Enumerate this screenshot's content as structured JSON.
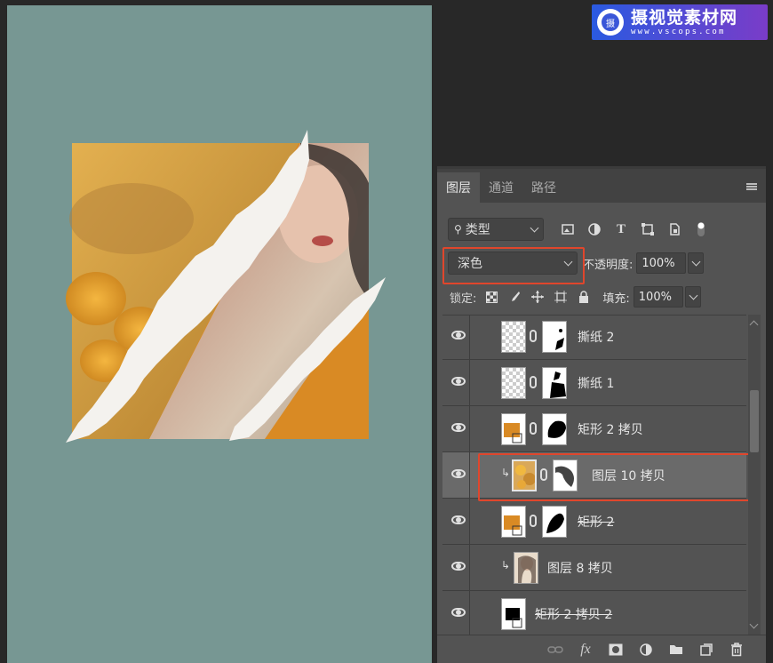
{
  "watermark": {
    "title": "摄视觉素材网",
    "url": "www.vscops.com",
    "logo_text": "摄"
  },
  "panel": {
    "tabs": [
      {
        "label": "图层",
        "active": true
      },
      {
        "label": "通道",
        "active": false
      },
      {
        "label": "路径",
        "active": false
      }
    ],
    "filter": {
      "label": "类型"
    },
    "filter_icons": [
      "image-filter-icon",
      "adjustment-filter-icon",
      "type-filter-icon",
      "shape-filter-icon",
      "smart-object-filter-icon",
      "filter-toggle-icon"
    ],
    "blend_mode": "深色",
    "opacity_label": "不透明度:",
    "opacity_value": "100%",
    "lock_label": "锁定:",
    "lock_icons": [
      "lock-transparent-icon",
      "lock-image-icon",
      "lock-position-icon",
      "lock-artboard-icon",
      "lock-all-icon"
    ],
    "fill_label": "填充:",
    "fill_value": "100%",
    "layers": [
      {
        "name": "撕纸 2",
        "thumb": "checker",
        "mask": "torn-small",
        "clipped": false,
        "selected": false,
        "strike": false
      },
      {
        "name": "撕纸 1",
        "thumb": "checker",
        "mask": "torn-large",
        "clipped": false,
        "selected": false,
        "strike": false
      },
      {
        "name": "矩形 2 拷贝",
        "thumb": "shape-orange",
        "mask": "blob",
        "clipped": false,
        "selected": false,
        "strike": false
      },
      {
        "name": "图层 10 拷贝",
        "thumb": "photo-roses",
        "mask": "brush",
        "clipped": true,
        "selected": true,
        "strike": false
      },
      {
        "name": "矩形 2",
        "thumb": "shape-orange",
        "mask": "blob-2",
        "clipped": false,
        "selected": false,
        "strike": true
      },
      {
        "name": "图层 8 拷贝",
        "thumb": "photo-woman",
        "mask": null,
        "clipped": true,
        "selected": false,
        "strike": false
      },
      {
        "name": "矩形 2 拷贝 2",
        "thumb": "shape-black",
        "mask": null,
        "clipped": false,
        "selected": false,
        "strike": true
      }
    ],
    "footer_icons": [
      "link-layers-icon",
      "fx-icon",
      "add-mask-icon",
      "adjustment-layer-icon",
      "new-group-icon",
      "new-layer-icon",
      "delete-layer-icon"
    ],
    "fx_label": "fx"
  },
  "colors": {
    "canvas": "#779793",
    "orange": "#d98a24",
    "highlight": "#e0462c"
  }
}
